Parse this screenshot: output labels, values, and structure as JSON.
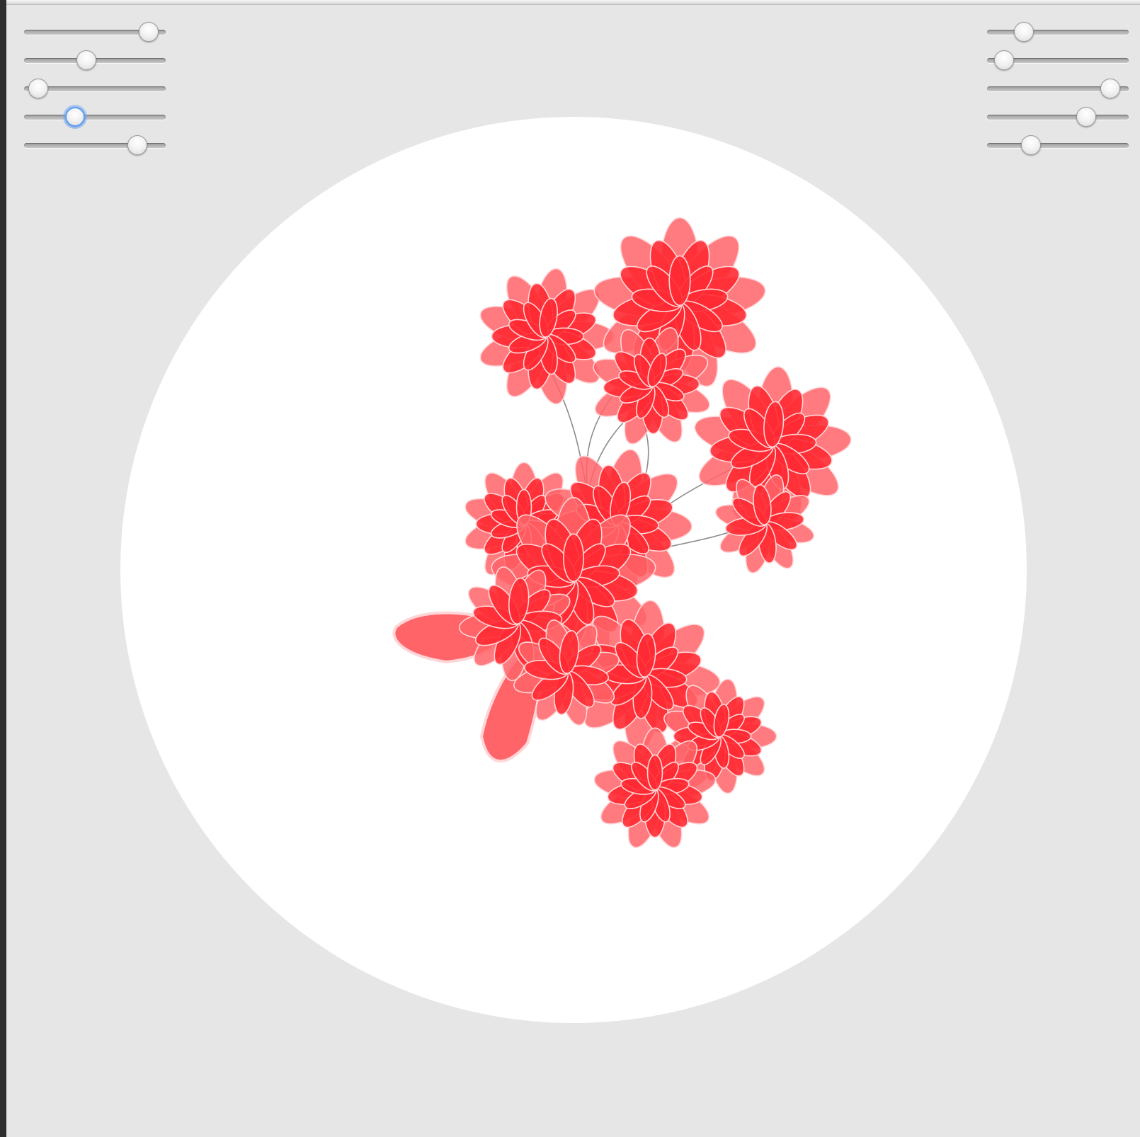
{
  "colors": {
    "background": "#e6e6e6",
    "canvas": "#ffffff",
    "petal": "#ff2a33",
    "petal_light": "#ff6469",
    "petal_outline": "#ffd6d8",
    "stem": "#8c8c8c",
    "focus_ring": "#5b9cf2"
  },
  "left_sliders": [
    {
      "id": "slider-1",
      "value": 0.88
    },
    {
      "id": "slider-2",
      "value": 0.44
    },
    {
      "id": "slider-3",
      "value": 0.1
    },
    {
      "id": "slider-4",
      "value": 0.36,
      "focused": true
    },
    {
      "id": "slider-5",
      "value": 0.8
    }
  ],
  "right_sliders": [
    {
      "id": "slider-6",
      "value": 0.26
    },
    {
      "id": "slider-7",
      "value": 0.12
    },
    {
      "id": "slider-8",
      "value": 0.87
    },
    {
      "id": "slider-9",
      "value": 0.7
    },
    {
      "id": "slider-10",
      "value": 0.31
    }
  ]
}
